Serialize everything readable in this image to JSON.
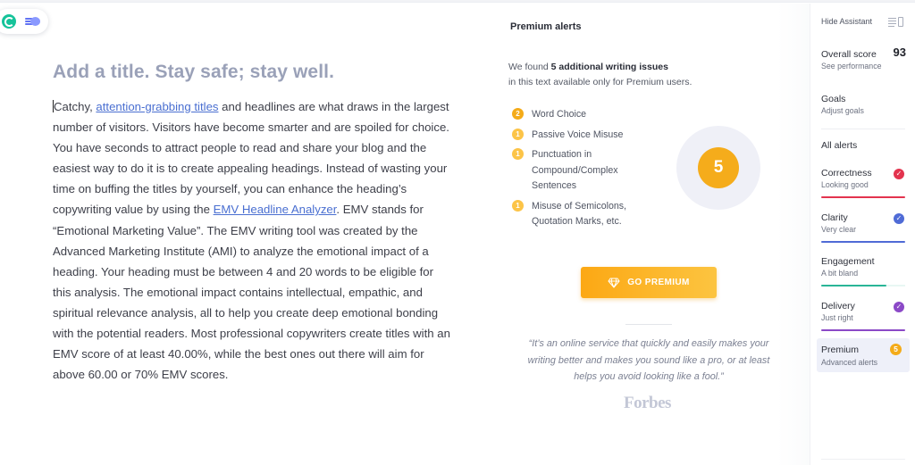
{
  "toolbar": {
    "logo_icon": "grammarly-logo-icon",
    "speed_icon": "goals-speed-icon"
  },
  "editor": {
    "title": "Add a title. Stay safe; stay well.",
    "body_parts": {
      "p1": "Catchy, ",
      "link1": "attention-grabbing titles",
      "p2": " and headlines are what draws in the largest number of visitors. Visitors have become smarter and are spoiled for choice. You have seconds to attract people to read and share your blog and the easiest way to do it is to create appealing headings. Instead of wasting your time on buffing the titles by yourself, you can enhance the heading’s copywriting value by using the ",
      "link2": "EMV Headline Analyzer",
      "p3": ". EMV stands for “Emotional Marketing Value”. The  EMV writing tool was created by the Advanced Marketing Institute (AMI) to analyze the emotional impact of a heading. Your heading must be between 4 and 20 words to be eligible for this analysis. The emotional impact contains intellectual, empathic, and spiritual relevance analysis, all to help you create deep emotional bonding with the potential readers. Most professional copywriters create titles with an EMV score of at least 40.00%, while the best ones out there will aim for above 60.00 or 70% EMV scores."
    }
  },
  "premium_panel": {
    "heading": "Premium alerts",
    "found_prefix": "We found ",
    "found_bold": "5 additional writing issues",
    "found_suffix": "in this text available only for Premium users.",
    "issues": [
      {
        "count": "2",
        "label": "Word Choice"
      },
      {
        "count": "1",
        "label": "Passive Voice Misuse"
      },
      {
        "count": "1",
        "label": "Punctuation in Compound/Complex Sentences"
      },
      {
        "count": "1",
        "label": "Misuse of Semicolons, Quotation Marks, etc."
      }
    ],
    "total": "5",
    "button_label": "GO PREMIUM",
    "button_icon": "diamond-icon",
    "quote": "“It’s an online service that quickly and easily makes your writing better and makes you sound like a pro, or at least helps you avoid looking like a fool.”",
    "quote_source": "Forbes",
    "accent_color": "#f5ac1b"
  },
  "sidebar": {
    "hide_label": "Hide Assistant",
    "overall": {
      "title": "Overall score",
      "score": "93",
      "sub": "See performance"
    },
    "goals": {
      "title": "Goals",
      "sub": "Adjust goals"
    },
    "alerts_heading": "All alerts",
    "categories": [
      {
        "title": "Correctness",
        "sub": "Looking good",
        "color": "#e3334e",
        "progress": 1.0,
        "checked": true
      },
      {
        "title": "Clarity",
        "sub": "Very clear",
        "color": "#4f6bd6",
        "progress": 1.0,
        "checked": true
      },
      {
        "title": "Engagement",
        "sub": "A bit bland",
        "color": "#29b597",
        "progress": 0.78,
        "checked": false
      },
      {
        "title": "Delivery",
        "sub": "Just right",
        "color": "#8b49c7",
        "progress": 1.0,
        "checked": true
      }
    ],
    "premium": {
      "title": "Premium",
      "sub": "Advanced alerts",
      "count": "5"
    }
  }
}
